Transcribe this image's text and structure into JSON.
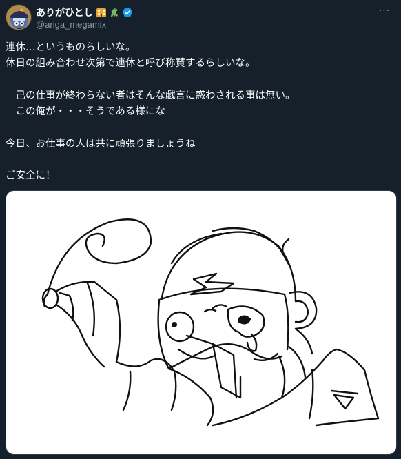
{
  "author": {
    "display_name": "ありがひとし",
    "handle": "@ariga_megamix",
    "verified": true,
    "avatar_icon": "character-avatar-icon",
    "name_emojis": [
      "building-emoji-icon",
      "dinosaur-emoji-icon"
    ]
  },
  "menu": {
    "more_icon": "more-dots-icon",
    "more_label": "···"
  },
  "tweet": {
    "lines": [
      "連休…というものらしいな。",
      "休日の組み合わせ次第で連休と呼び称賛するらしいな。",
      "",
      "　己の仕事が終わらない者はそんな戯言に惑わされる事は無い。",
      "　この俺が・・・そうである様にな",
      "",
      "今日、お仕事の人は共に頑張りましょうね",
      "",
      "ご安全に！"
    ]
  },
  "media": {
    "kind": "line-art-sketch",
    "background": "#ffffff"
  },
  "colors": {
    "background": "#15202b",
    "text": "#f7f9f9",
    "secondary": "#8b98a5",
    "verified": "#1d9bf0"
  }
}
